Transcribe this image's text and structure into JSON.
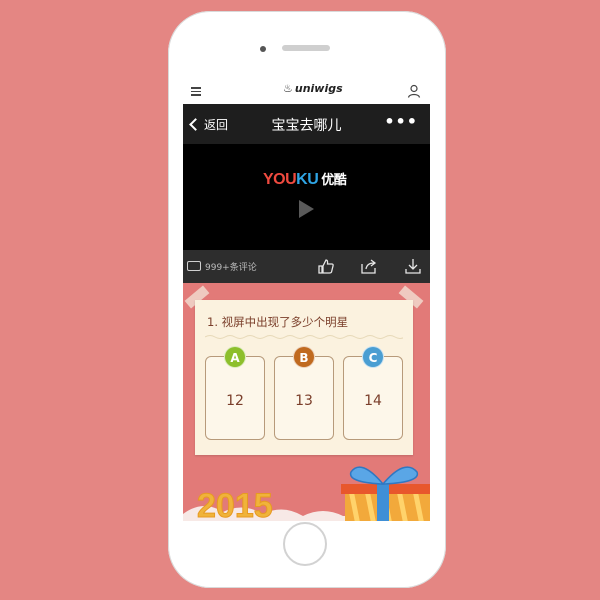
{
  "browser": {
    "logo_text": "uniwigs"
  },
  "app": {
    "back_label": "返回",
    "title": "宝宝去哪儿",
    "more_label": "•••"
  },
  "video": {
    "brand_you": "YOU",
    "brand_ku": "KU",
    "brand_cn": "优酷"
  },
  "actions": {
    "comments_label": "999+条评论"
  },
  "quiz": {
    "question": "1. 视屏中出现了多少个明星",
    "options": [
      {
        "letter": "A",
        "value": "12"
      },
      {
        "letter": "B",
        "value": "13"
      },
      {
        "letter": "C",
        "value": "14"
      }
    ]
  },
  "banner": {
    "year": "2015"
  },
  "colors": {
    "background": "#e48683",
    "screen_bg": "#e27a78",
    "navbar": "#1e1e1e",
    "card": "#fbf2df",
    "badge_a": "#8dbf2c",
    "badge_b": "#c06a1f",
    "badge_c": "#4a9ed2"
  },
  "icons": [
    "menu-icon",
    "user-icon",
    "back-chevron-icon",
    "more-icon",
    "play-icon",
    "comment-icon",
    "thumbs-up-icon",
    "share-icon",
    "download-icon",
    "gift-icon"
  ]
}
